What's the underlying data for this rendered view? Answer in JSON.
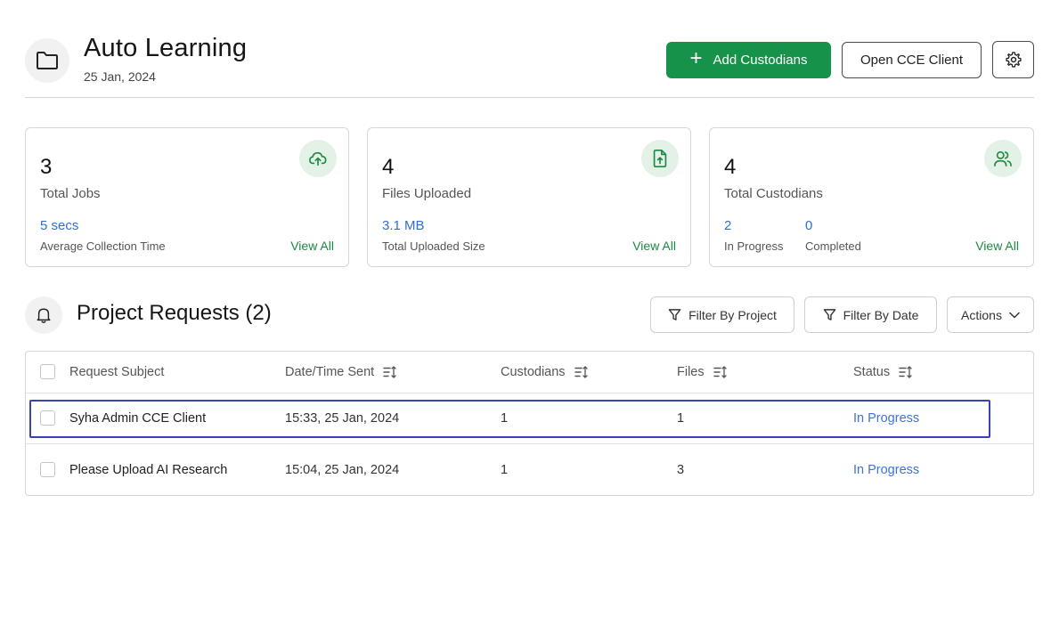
{
  "header": {
    "title": "Auto Learning",
    "date": "25 Jan, 2024",
    "add_button_label": "Add Custodians",
    "open_button_label": "Open CCE Client"
  },
  "cards": [
    {
      "number": "3",
      "label": "Total Jobs",
      "sub_value": "5 secs",
      "sub_label": "Average Collection Time",
      "link": "View All",
      "icon": "cloud-upload-icon"
    },
    {
      "number": "4",
      "label": "Files Uploaded",
      "sub_value": "3.1 MB",
      "sub_label": "Total Uploaded Size",
      "link": "View All",
      "icon": "file-upload-icon"
    },
    {
      "number": "4",
      "label": "Total Custodians",
      "sub_values": [
        {
          "value": "2",
          "label": "In Progress"
        },
        {
          "value": "0",
          "label": "Completed"
        }
      ],
      "link": "View All",
      "icon": "users-icon"
    }
  ],
  "requests": {
    "title": "Project Requests (2)",
    "filters": {
      "project": "Filter By Project",
      "date": "Filter By Date",
      "actions": "Actions"
    },
    "columns": [
      "Request Subject",
      "Date/Time Sent",
      "Custodians",
      "Files",
      "Status"
    ],
    "rows": [
      {
        "subject": "Syha Admin CCE Client",
        "sent": "15:33, 25 Jan, 2024",
        "custodians": "1",
        "files": "1",
        "status": "In Progress"
      },
      {
        "subject": "Please Upload AI Research",
        "sent": "15:04, 25 Jan, 2024",
        "custodians": "1",
        "files": "3",
        "status": "In Progress"
      }
    ]
  },
  "colors": {
    "primary_green": "#17924a",
    "link_blue": "#3d74d8",
    "highlight": "#3a42b8",
    "icon_bg": "#e3f1e7"
  }
}
